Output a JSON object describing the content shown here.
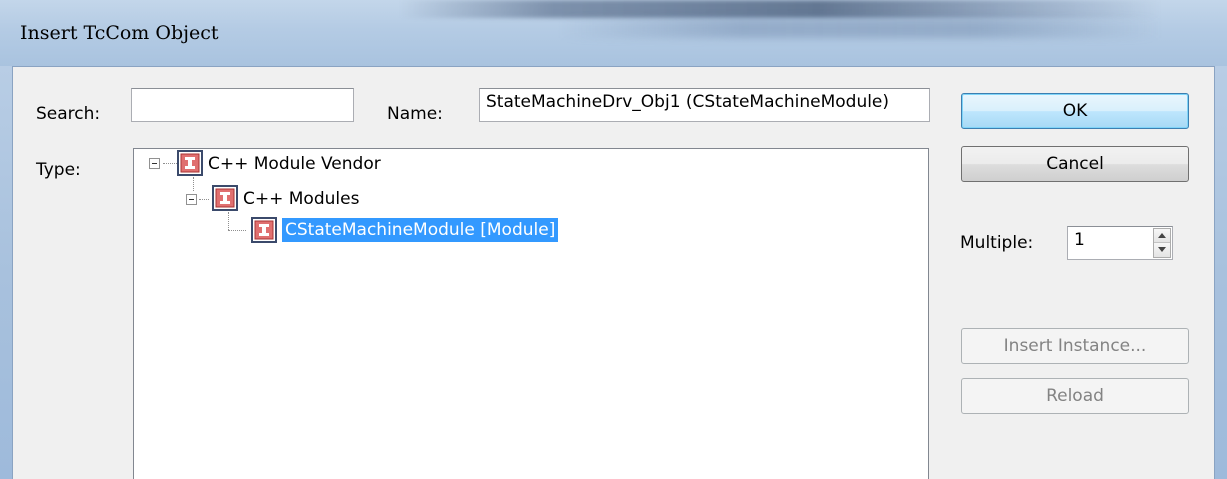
{
  "window": {
    "title": "Insert TcCom Object"
  },
  "form": {
    "search_label": "Search:",
    "search_value": "",
    "name_label": "Name:",
    "name_value": "StateMachineDrv_Obj1 (CStateMachineModule)",
    "type_label": "Type:",
    "multiple_label": "Multiple:",
    "multiple_value": "1"
  },
  "buttons": {
    "ok": "OK",
    "cancel": "Cancel",
    "insert_instance": "Insert Instance...",
    "reload": "Reload"
  },
  "tree": {
    "items": [
      {
        "label": "C++ Module Vendor",
        "level": 0,
        "expanded": true,
        "selected": false
      },
      {
        "label": "C++ Modules",
        "level": 1,
        "expanded": true,
        "selected": false
      },
      {
        "label": "CStateMachineModule [Module]",
        "level": 2,
        "selected": true
      }
    ]
  },
  "colors": {
    "selection": "#3399ff",
    "module_icon": "#d9534f",
    "default_button_border": "#3c7fb1"
  }
}
